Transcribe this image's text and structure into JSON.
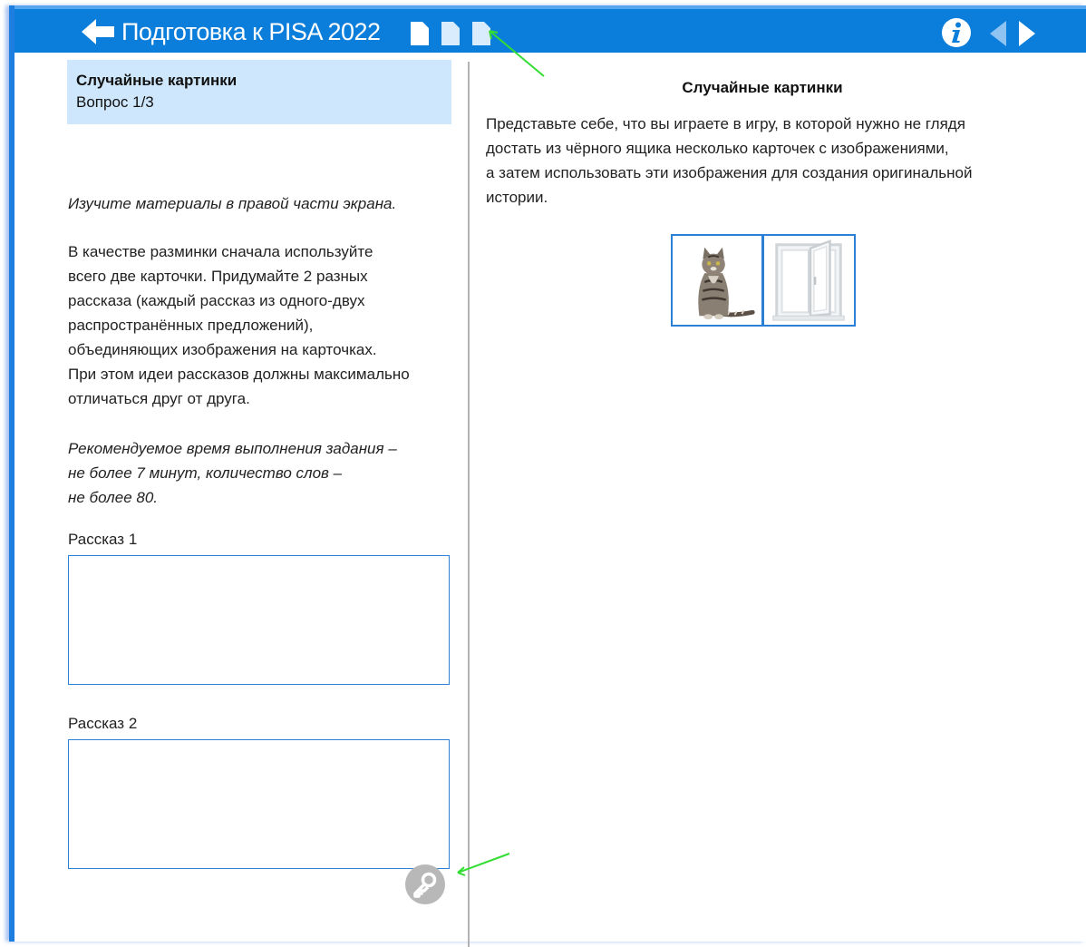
{
  "header": {
    "title": "Подготовка к PISA 2022",
    "icons": [
      "back-arrow-icon",
      "page-icon",
      "page-icon",
      "page-icon",
      "info-icon",
      "prev-arrow-icon",
      "next-arrow-icon"
    ],
    "background": "#0b7dda"
  },
  "left": {
    "question_title": "Случайные картинки",
    "question_number": "Вопрос 1/3",
    "instruction": "Изучите материалы в правой части экрана.",
    "task_lines": [
      "В качестве разминки сначала используйте",
      "всего две карточки. Придумайте 2 разных",
      "рассказа (каждый рассказ из одного-двух",
      "распространённых предложений),",
      "объединяющих изображения на карточках.",
      "При этом идеи рассказов должны максимально",
      "отличаться друг от друга."
    ],
    "recommendation_lines": [
      "Рекомендуемое время выполнения задания –",
      "не более 7 минут, количество слов –",
      "не более 80."
    ],
    "story1_label": "Рассказ 1",
    "story1_value": "",
    "story2_label": "Рассказ 2",
    "story2_value": ""
  },
  "right": {
    "title": "Случайные картинки",
    "text_lines": [
      "Представьте себе, что вы играете в игру, в которой нужно не глядя",
      "достать из чёрного ящика несколько карточек с изображениями,",
      "а затем использовать эти изображения для создания оригинальной",
      "истории."
    ],
    "cards": [
      "cat-image",
      "window-image"
    ]
  },
  "colors": {
    "accent": "#0b7dda",
    "question_header_bg": "#cfe7fc",
    "card_border": "#2b7fd4",
    "annotation_arrow": "#33dd33",
    "key_button": "#b8b8b8"
  }
}
